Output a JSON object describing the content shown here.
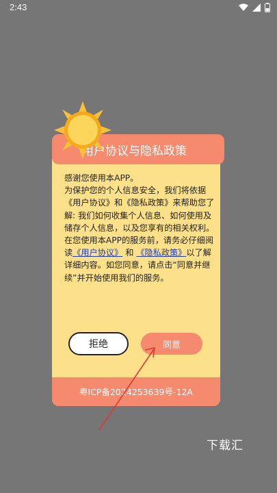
{
  "status_bar": {
    "time": "2:43"
  },
  "dialog": {
    "title": "用户协议与隐私政策",
    "intro": "感谢您使用本APP。",
    "paragraph1_pre": "为保护您的个人信息安全，我们将依据《用户协议》和《隐私政策》来帮助您了解: 我们如何收集个人信息、如何使用及储存个人信息，以及您享有的相关权利。",
    "paragraph2_pre": "在您使用本APP的服务前，请务必仔细阅读",
    "user_agreement_link": "《用户协议》",
    "and_text": "和",
    "privacy_policy_link": "《隐私政策》",
    "paragraph2_post": "以了解详细内容。如您同意，请点击“同意并继续”并开始使用我们的服务。",
    "reject_label": "拒绝",
    "agree_label": "同意",
    "footer": "粤ICP备2024253639号-12A"
  },
  "watermark": "下载汇",
  "icons": {
    "status": [
      "wifi-icon",
      "signal-icon",
      "battery-icon"
    ],
    "decoration": "sun-icon"
  },
  "colors": {
    "background": "#767676",
    "dialog_bg": "#fde08a",
    "accent": "#f68a6e",
    "link": "#1b3ec4",
    "arrow": "#e03a2e"
  }
}
